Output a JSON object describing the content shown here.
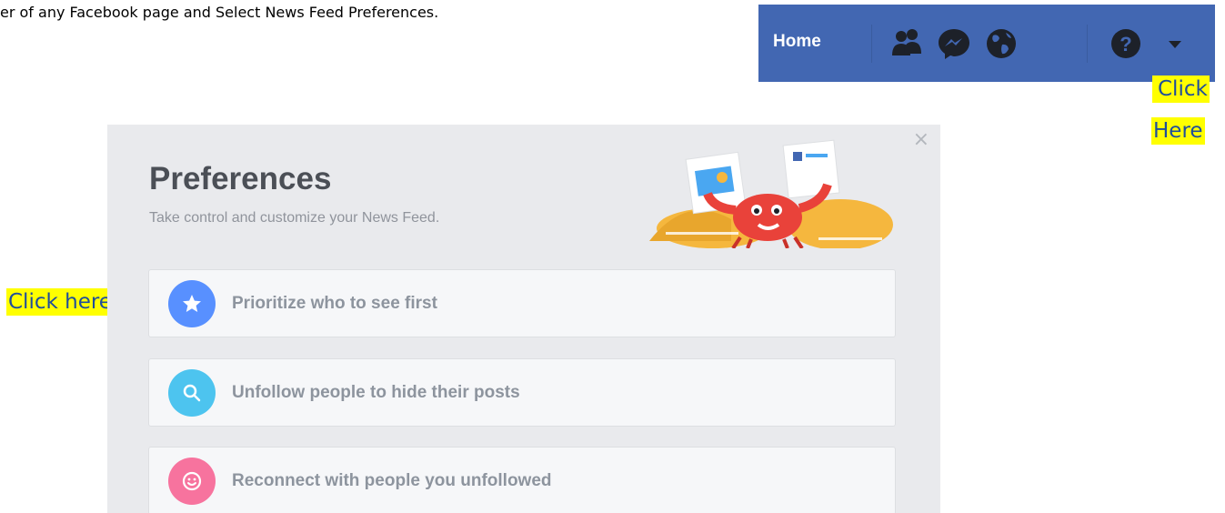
{
  "instruction": "er of any Facebook page and Select News Feed Preferences.",
  "fbbar": {
    "home_label": "Home",
    "bg_color": "#4267b2",
    "icons": [
      "friends-icon",
      "messenger-icon",
      "globe-icon",
      "help-icon",
      "dropdown-arrow-icon"
    ]
  },
  "callouts": {
    "top_right": [
      "Click",
      "Here"
    ],
    "left": "Click here"
  },
  "dialog": {
    "close_label": "×",
    "title": "Preferences",
    "subtitle": "Take control and customize your News Feed.",
    "options": [
      {
        "label": "Prioritize who to see first",
        "icon": "star-icon",
        "color": "#5890ff"
      },
      {
        "label": "Unfollow people to hide their posts",
        "icon": "search-icon",
        "color": "#4dc4ef"
      },
      {
        "label": "Reconnect with people you unfollowed",
        "icon": "smiley-icon",
        "color": "#f7739e"
      }
    ]
  }
}
